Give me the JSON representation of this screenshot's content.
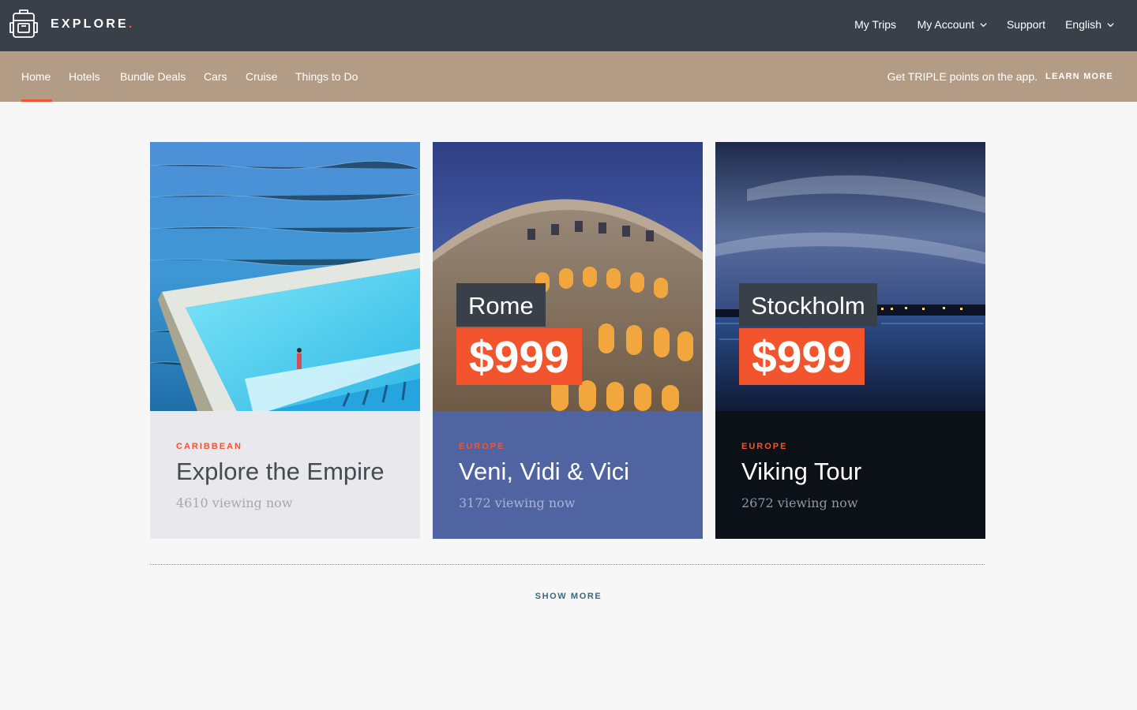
{
  "brand": {
    "name": "EXPLORE",
    "dot": "."
  },
  "topnav": {
    "my_trips": "My Trips",
    "my_account": "My Account",
    "support": "Support",
    "language": "English"
  },
  "subnav": {
    "items": [
      "Home",
      "Hotels",
      "Bundle Deals",
      "Cars",
      "Cruise",
      "Things to Do"
    ],
    "active": "Home",
    "promo_text": "Get TRIPLE points on the app.",
    "learn_more": "LEARN MORE"
  },
  "cards": [
    {
      "region": "CARIBBEAN",
      "title": "Explore the Empire",
      "viewing": "4610 viewing now",
      "image": "ocean-pool-photo",
      "body_color": "#e9e8ec"
    },
    {
      "region": "EUROPE",
      "title": "Veni, Vidi & Vici",
      "viewing": "3172 viewing now",
      "city": "Rome",
      "price": "$999",
      "image": "colosseum-photo",
      "body_color": "#5064a2"
    },
    {
      "region": "EUROPE",
      "title": "Viking Tour",
      "viewing": "2672 viewing now",
      "city": "Stockholm",
      "price": "$999",
      "image": "stockholm-night-photo",
      "body_color": "#0c1017"
    }
  ],
  "show_more": "SHOW MORE",
  "colors": {
    "topbar": "#394049",
    "subnav": "#b39c86",
    "accent": "#f2542d",
    "show_more": "#3c6876",
    "page_bg": "#f7f7f7"
  }
}
